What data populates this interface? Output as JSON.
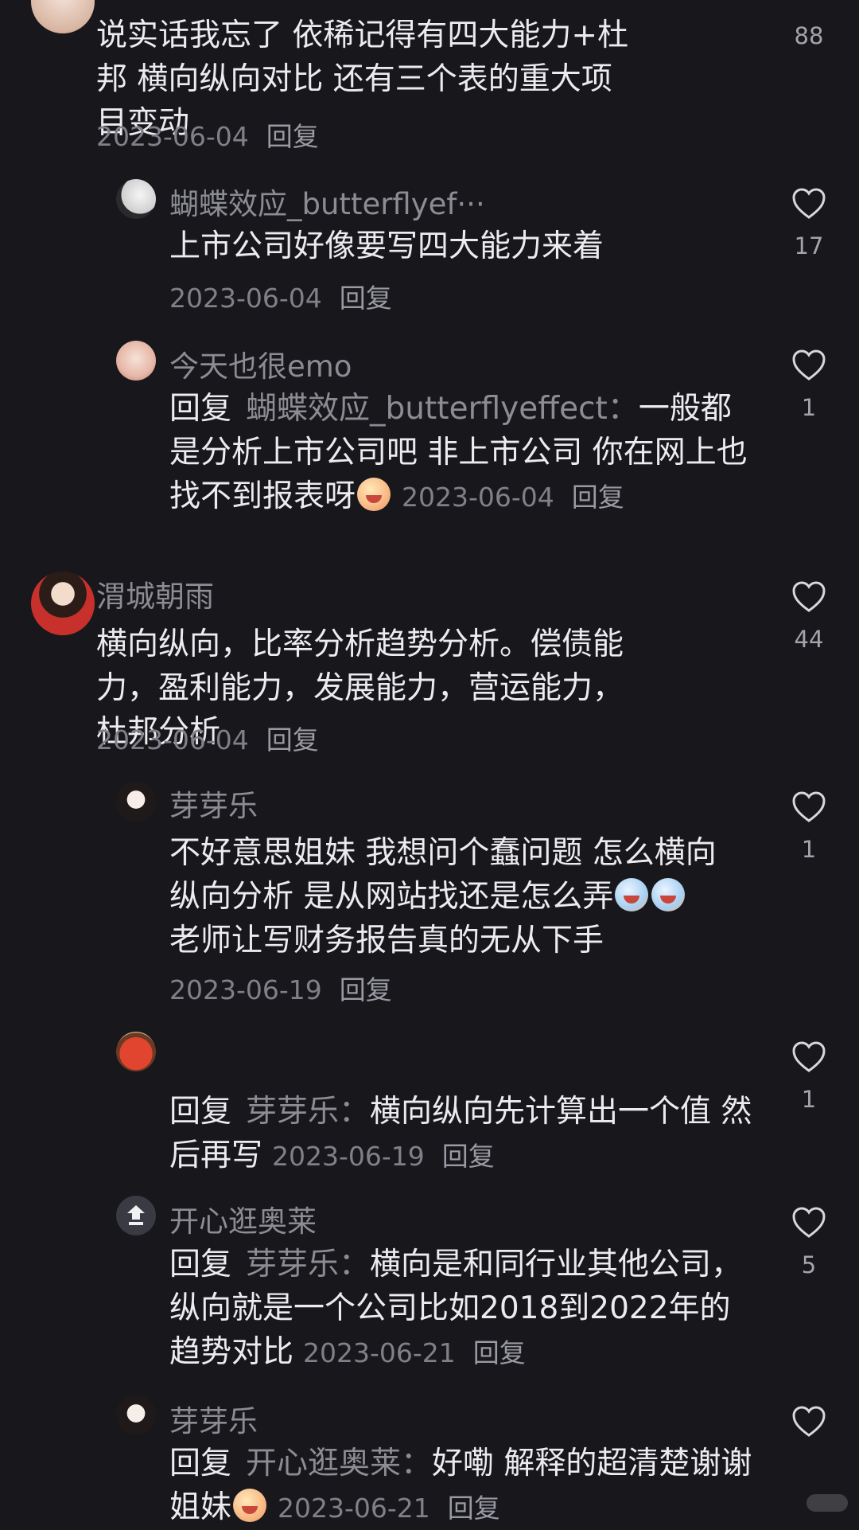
{
  "comments": [
    {
      "text": "说实话我忘了 依稀记得有四大能力+杜邦 横向纵向对比 还有三个表的重大项目变动",
      "date": "2023-06-04",
      "reply_label": "回复",
      "likes": "88"
    },
    {
      "username": "蝴蝶效应_butterflyef···",
      "text": "上市公司好像要写四大能力来着",
      "date": "2023-06-04",
      "reply_label": "回复",
      "likes": "17"
    },
    {
      "username": "今天也很emo",
      "reply_prefix": "回复",
      "reply_target": "蝴蝶效应_butterflyeffect：",
      "text": "一般都是分析上市公司吧 非上市公司 你在网上也找不到报表呀",
      "date": "2023-06-04",
      "reply_label": "回复",
      "likes": "1"
    },
    {
      "username": "渭城朝雨",
      "text": "横向纵向，比率分析趋势分析。偿债能力，盈利能力，发展能力，营运能力，杜邦分析",
      "date": "2023-06-04",
      "reply_label": "回复",
      "likes": "44"
    },
    {
      "username": "芽芽乐",
      "text_line1": "不好意思姐妹 我想问个蠢问题 怎么横向",
      "text_line2": "纵向分析 是从网站找还是怎么弄",
      "text_line3": "老师让写财务报告真的无从下手",
      "date": "2023-06-19",
      "reply_label": "回复",
      "likes": "1"
    },
    {
      "reply_prefix": "回复",
      "reply_target": "芽芽乐：",
      "text": "横向纵向先计算出一个值 然后再写",
      "date": "2023-06-19",
      "reply_label": "回复",
      "likes": "1"
    },
    {
      "username": "开心逛奥莱",
      "reply_prefix": "回复",
      "reply_target": "芽芽乐：",
      "text": "横向是和同行业其他公司，纵向就是一个公司比如2018到2022年的趋势对比",
      "date": "2023-06-21",
      "reply_label": "回复",
      "likes": "5"
    },
    {
      "username": "芽芽乐",
      "reply_prefix": "回复",
      "reply_target": "开心逛奥莱：",
      "text": "好嘞 解释的超清楚谢谢姐妹",
      "date": "2023-06-21",
      "reply_label": "回复",
      "likes": ""
    }
  ],
  "icons": {
    "like": "heart-outline-icon",
    "emoji_cry": "crying-face-emoji",
    "emoji_tears": "tearful-face-emoji"
  }
}
